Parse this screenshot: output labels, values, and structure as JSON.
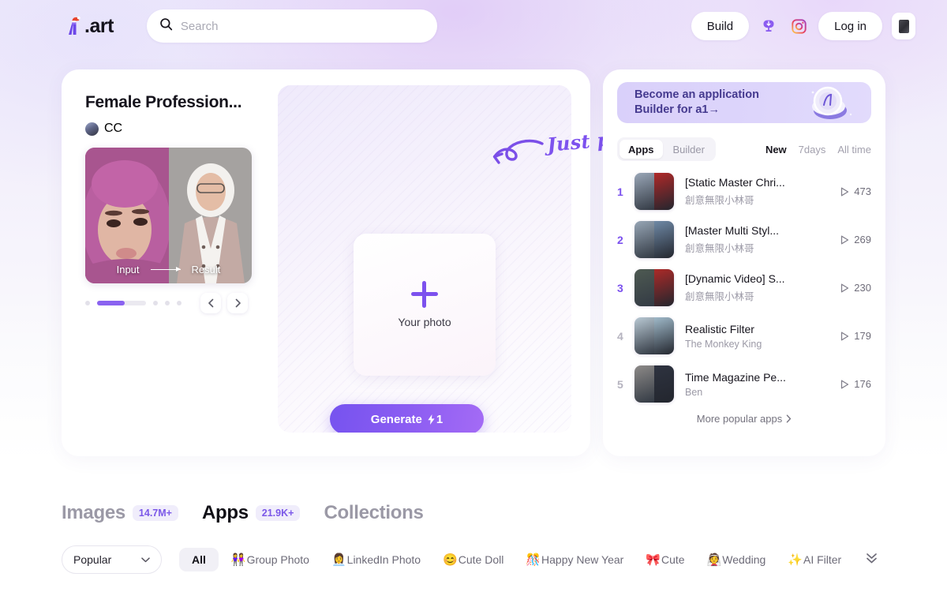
{
  "header": {
    "logo_text": ".art",
    "logo_icon": "ai-art-logo-icon",
    "search": {
      "placeholder": "Search",
      "value": ""
    },
    "build_label": "Build",
    "login_label": "Log in",
    "discord_icon": "discord-icon",
    "instagram_icon": "instagram-icon",
    "app_icon": "mobile-app-icon"
  },
  "hero": {
    "promo": {
      "title": "Female Profession...",
      "author": "CC",
      "input_label": "Input",
      "result_label": "Result",
      "prev_icon": "chevron-left-icon",
      "next_icon": "chevron-right-icon"
    },
    "generate": {
      "upload_label": "Your photo",
      "plus_icon": "plus-icon",
      "button_label": "Generate",
      "cost_icon": "lightning-icon",
      "cost_value": "1"
    },
    "annotation": {
      "text": "Just play it!",
      "arrow_icon": "curved-arrow-left-icon"
    }
  },
  "right_panel": {
    "banner": {
      "line1": "Become an application",
      "line2": "Builder for a1→",
      "coins_icon": "coins-icon"
    },
    "segments": [
      {
        "label": "Apps",
        "active": true
      },
      {
        "label": "Builder",
        "active": false
      }
    ],
    "filters": [
      {
        "label": "New",
        "active": true
      },
      {
        "label": "7days",
        "active": false
      },
      {
        "label": "All time",
        "active": false
      }
    ],
    "ranking": [
      {
        "rank": "1",
        "title": "[Static Master Chri...",
        "author": "創意無限小林哥",
        "plays": "473",
        "c1": "#9aa7b8",
        "c2": "#b02828"
      },
      {
        "rank": "2",
        "title": "[Master Multi Styl...",
        "author": "創意無限小林哥",
        "plays": "269",
        "c1": "#97a6b6",
        "c2": "#6f89a6"
      },
      {
        "rank": "3",
        "title": "[Dynamic Video] S...",
        "author": "創意無限小林哥",
        "plays": "230",
        "c1": "#4e5a52",
        "c2": "#ac2a28"
      },
      {
        "rank": "4",
        "title": "Realistic Filter",
        "author": "The Monkey King",
        "plays": "179",
        "c1": "#b9c9d4",
        "c2": "#9fb9c9"
      },
      {
        "rank": "5",
        "title": "Time Magazine Pe...",
        "author": "Ben",
        "plays": "176",
        "c1": "#8d8a88",
        "c2": "#2e3340"
      }
    ],
    "more_label": "More popular apps",
    "more_icon": "chevron-right-icon",
    "play_icon": "play-icon"
  },
  "section": {
    "tabs": [
      {
        "label": "Images",
        "count": "14.7M+",
        "active": false
      },
      {
        "label": "Apps",
        "count": "21.9K+",
        "active": true
      },
      {
        "label": "Collections",
        "count": "",
        "active": false
      }
    ],
    "sort": {
      "label": "Popular",
      "icon": "chevron-down-icon"
    },
    "chips": [
      {
        "emoji": "",
        "label": "All",
        "active": true
      },
      {
        "emoji": "👭",
        "label": "Group Photo",
        "active": false
      },
      {
        "emoji": "👩‍💼",
        "label": "LinkedIn Photo",
        "active": false
      },
      {
        "emoji": "😊",
        "label": "Cute Doll",
        "active": false
      },
      {
        "emoji": "🎊",
        "label": "Happy New Year",
        "active": false
      },
      {
        "emoji": "🎀",
        "label": "Cute",
        "active": false
      },
      {
        "emoji": "👰",
        "label": "Wedding",
        "active": false
      },
      {
        "emoji": "✨",
        "label": "AI Filter",
        "active": false
      }
    ],
    "expand_icon": "chevrons-down-icon"
  },
  "colors": {
    "accent": "#7b51ee",
    "accent_light": "#a46bf5",
    "badge_bg": "#f0edfb"
  }
}
